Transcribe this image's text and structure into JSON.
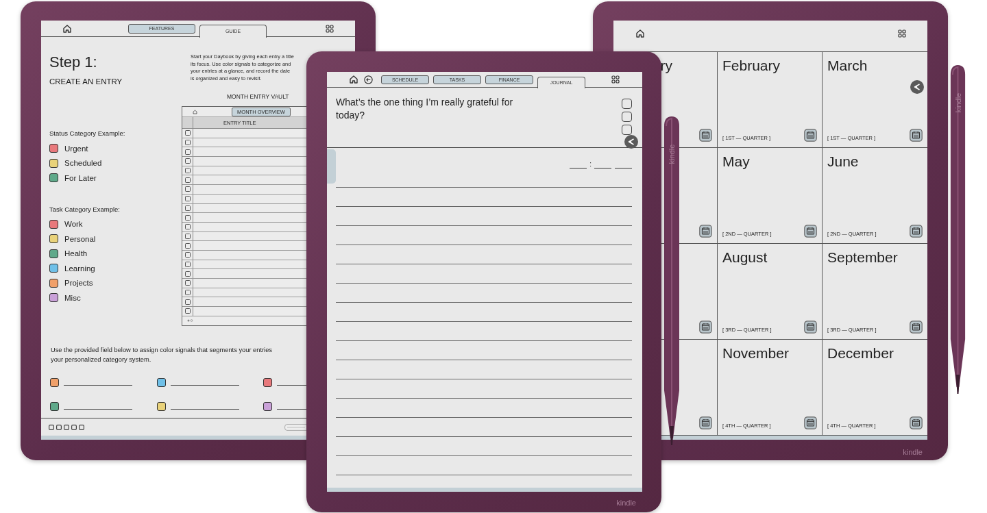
{
  "left_device": {
    "tabs": [
      {
        "label": "FEATURES",
        "selected": false
      },
      {
        "label": "GUIDE",
        "selected": true
      }
    ],
    "step_title": "Step 1:",
    "step_subtitle": "CREATE AN ENTRY",
    "intro_lines": [
      "Start your Daybook by giving each entry a title",
      "its focus. Use color signals to categorize and",
      "your entries at a glance, and record the date",
      "is organized and easy to revisit."
    ],
    "vault": {
      "title": "MONTH ENTRY VAULT",
      "tab": "MONTH OVERVIEW",
      "column": "ENTRY TITLE",
      "rows": [
        {
          "checked": false
        },
        {
          "checked": false
        },
        {
          "checked": false
        },
        {
          "checked": false
        },
        {
          "checked": false
        },
        {
          "checked": false
        },
        {
          "checked": false
        },
        {
          "checked": false
        },
        {
          "checked": false
        },
        {
          "checked": false
        },
        {
          "checked": false
        },
        {
          "checked": false
        },
        {
          "checked": false
        },
        {
          "checked": false
        },
        {
          "checked": false
        },
        {
          "checked": false
        },
        {
          "checked": false
        },
        {
          "checked": false
        },
        {
          "checked": false
        },
        {
          "checked": false
        }
      ]
    },
    "status_heading": "Status Category Example:",
    "status_categories": [
      {
        "label": "Urgent",
        "color": "#e8797c"
      },
      {
        "label": "Scheduled",
        "color": "#e9d27a"
      },
      {
        "label": "For Later",
        "color": "#5fa98a"
      }
    ],
    "task_heading": "Task Category Example:",
    "task_categories": [
      {
        "label": "Work",
        "color": "#e8797c"
      },
      {
        "label": "Personal",
        "color": "#e9d27a"
      },
      {
        "label": "Health",
        "color": "#5fa98a"
      },
      {
        "label": "Learning",
        "color": "#6fc0e8"
      },
      {
        "label": "Projects",
        "color": "#f0a06a"
      },
      {
        "label": "Misc",
        "color": "#c9a1d8"
      }
    ],
    "instructions_lines": [
      "Use the provided field below to assign color signals that segments your entries",
      "your personalized category system."
    ],
    "custom_fields": [
      {
        "color": "#f0a06a"
      },
      {
        "color": "#6fc0e8"
      },
      {
        "color": "#e8797c"
      },
      {
        "color": "#5fa98a"
      },
      {
        "color": "#e9d27a"
      },
      {
        "color": "#c9a1d8"
      }
    ]
  },
  "center_device": {
    "tabs": [
      {
        "label": "SCHEDULE",
        "selected": false
      },
      {
        "label": "TASKS",
        "selected": false
      },
      {
        "label": "FINANCE",
        "selected": false
      },
      {
        "label": "JOURNAL",
        "selected": true
      }
    ],
    "prompt": "What’s the one thing I’m really grateful for today?",
    "checkboxes": [
      {
        "checked": false
      },
      {
        "checked": false
      },
      {
        "checked": false
      }
    ],
    "time_separator": ":",
    "brand": "kindle"
  },
  "right_device": {
    "months": [
      {
        "name": "ry",
        "pen_button": false
      },
      {
        "name": "February",
        "quarter": "[ 1ST — QUARTER ]",
        "pen_button": false
      },
      {
        "name": "March",
        "quarter": "[ 1ST — QUARTER ]",
        "pen_button": true
      },
      {
        "pen_button": false
      },
      {
        "name": "May",
        "quarter": "[ 2ND — QUARTER ]",
        "pen_button": false
      },
      {
        "name": "June",
        "quarter": "[ 2ND — QUARTER ]",
        "pen_button": false
      },
      {
        "pen_button": false
      },
      {
        "name": "August",
        "quarter": "[ 3RD — QUARTER ]",
        "pen_button": false
      },
      {
        "name": "September",
        "quarter": "[ 3RD — QUARTER ]",
        "pen_button": false
      },
      {
        "pen_button": false
      },
      {
        "name": "November",
        "quarter": "[ 4TH — QUARTER ]",
        "pen_button": false
      },
      {
        "name": "December",
        "quarter": "[ 4TH — QUARTER ]",
        "pen_button": false
      }
    ],
    "brand": "kindle"
  },
  "styluses": [
    {
      "brand": "kindle"
    },
    {
      "brand": "kindle"
    }
  ]
}
